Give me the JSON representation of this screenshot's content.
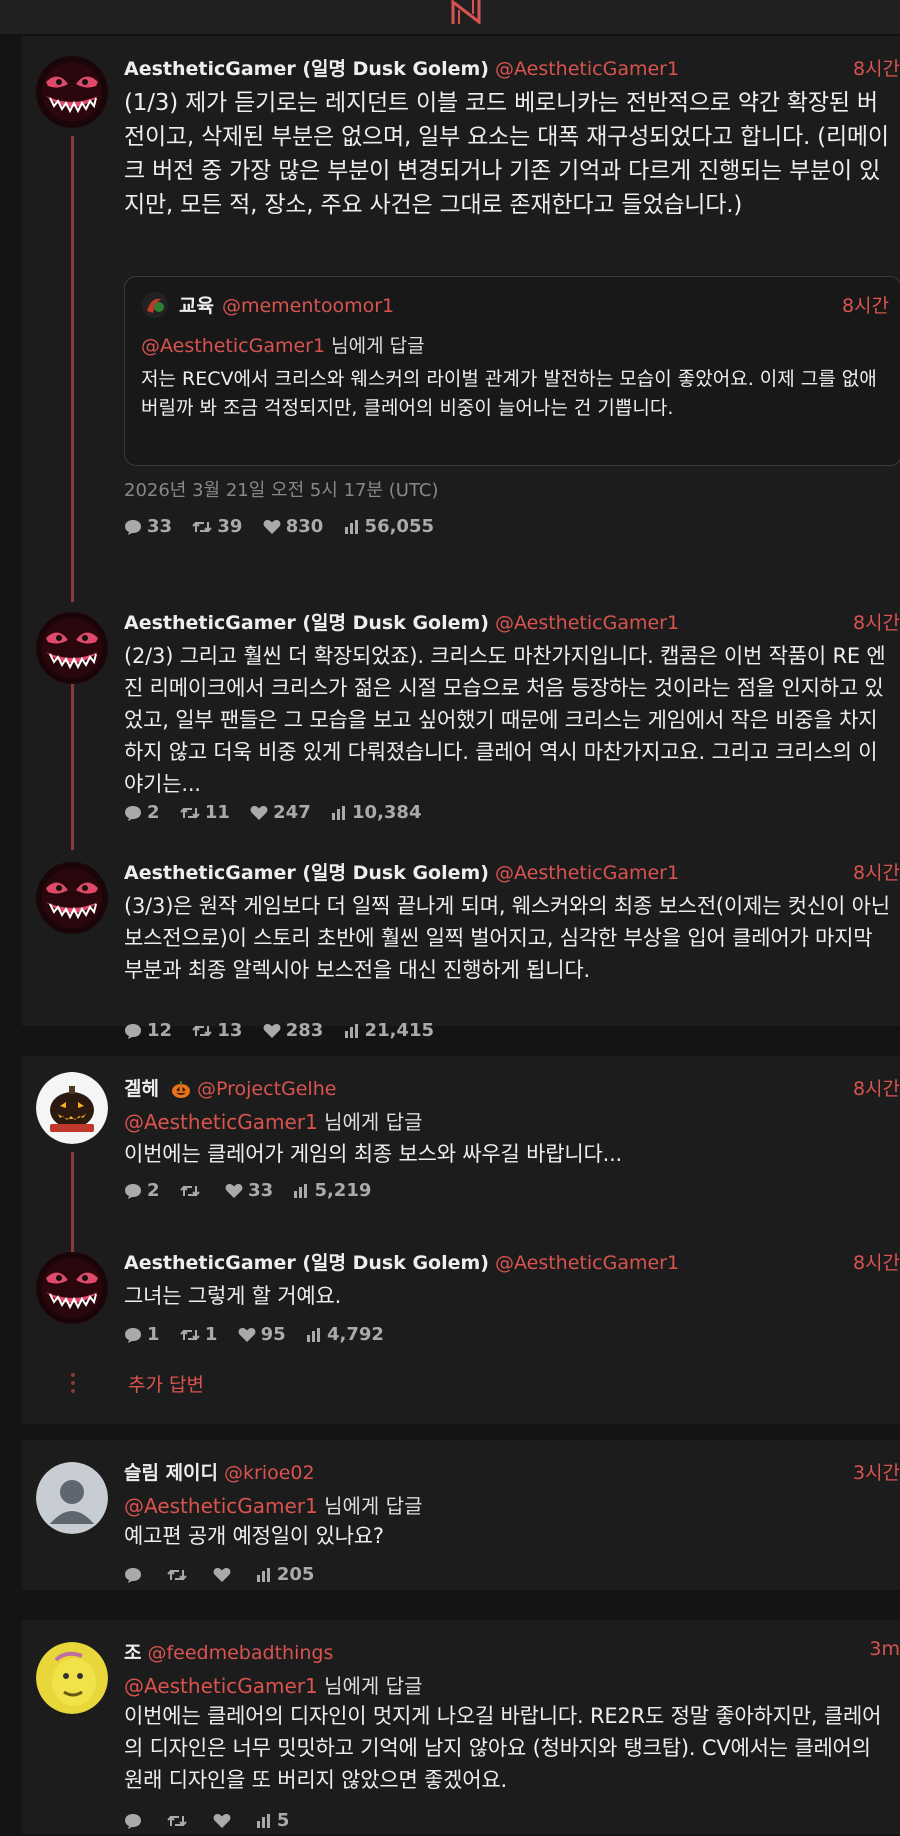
{
  "brand": {
    "accent": "#d9534f",
    "background": "#141414",
    "card": "#1c1c1c"
  },
  "tweets": [
    {
      "name": "AestheticGamer (일명 Dusk Golem)",
      "handle": "@AestheticGamer1",
      "time": "8시간",
      "text": "(1/3) 제가 듣기로는 레지던트 이블 코드 베로니카는 전반적으로 약간 확장된 버전이고, 삭제된 부분은 없으며, 일부 요소는 대폭 재구성되었다고 합니다. (리메이크 버전 중 가장 많은 부분이 변경되거나 기존 기억과 다르게 진행되는 부분이 있지만, 모든 적, 장소, 주요 사건은 그대로 존재한다고 들었습니다.)",
      "quote": {
        "name": "교육",
        "handle": "@mementoomor1",
        "time": "8시간",
        "reply_handle": "@AestheticGamer1",
        "reply_suffix": "님에게 답글",
        "text": "저는 RECV에서 크리스와 웨스커의 라이벌 관계가 발전하는 모습이 좋았어요. 이제 그를 없애버릴까 봐 조금 걱정되지만, 클레어의 비중이 늘어나는 건 기쁩니다."
      },
      "date": "2026년 3월 21일 오전 5시 17분 (UTC)",
      "stats": {
        "replies": "33",
        "retweets": "39",
        "likes": "830",
        "views": "56,055"
      }
    },
    {
      "name": "AestheticGamer (일명 Dusk Golem)",
      "handle": "@AestheticGamer1",
      "time": "8시간",
      "text": "(2/3) 그리고 훨씬 더 확장되었죠). 크리스도 마찬가지입니다. 캡콤은 이번 작품이 RE 엔진 리메이크에서 크리스가 젊은 시절 모습으로 처음 등장하는 것이라는 점을 인지하고 있었고, 일부 팬들은 그 모습을 보고 싶어했기 때문에 크리스는 게임에서 작은 비중을 차지하지 않고 더욱 비중 있게 다뤄졌습니다. 클레어 역시 마찬가지고요. 그리고 크리스의 이야기는...",
      "stats": {
        "replies": "2",
        "retweets": "11",
        "likes": "247",
        "views": "10,384"
      }
    },
    {
      "name": "AestheticGamer (일명 Dusk Golem)",
      "handle": "@AestheticGamer1",
      "time": "8시간",
      "text": "(3/3)은 원작 게임보다 더 일찍 끝나게 되며, 웨스커와의 최종 보스전(이제는 컷신이 아닌 보스전으로)이 스토리 초반에 훨씬 일찍 벌어지고, 심각한 부상을 입어 클레어가 마지막 부분과 최종 알렉시아 보스전을 대신 진행하게 됩니다.",
      "stats": {
        "replies": "12",
        "retweets": "13",
        "likes": "283",
        "views": "21,415"
      }
    }
  ],
  "replies": [
    {
      "name": "겔헤",
      "handle": "@ProjectGelhe",
      "time": "8시간",
      "reply_handle": "@AestheticGamer1",
      "reply_suffix": "님에게 답글",
      "text": "이번에는 클레어가 게임의 최종 보스와 싸우길 바랍니다...",
      "stats": {
        "replies": "2",
        "retweets": "",
        "likes": "33",
        "views": "5,219"
      }
    },
    {
      "name": "AestheticGamer (일명 Dusk Golem)",
      "handle": "@AestheticGamer1",
      "time": "8시간",
      "text": "그녀는 그렇게 할 거예요.",
      "stats": {
        "replies": "1",
        "retweets": "1",
        "likes": "95",
        "views": "4,792"
      }
    },
    {
      "name": "슬림 제이디",
      "handle": "@krioe02",
      "time": "3시간",
      "reply_handle": "@AestheticGamer1",
      "reply_suffix": "님에게 답글",
      "text": "예고편 공개 예정일이 있나요?",
      "stats": {
        "replies": "",
        "retweets": "",
        "likes": "",
        "views": "205"
      }
    },
    {
      "name": "조",
      "handle": "@feedmebadthings",
      "time": "3m",
      "reply_handle": "@AestheticGamer1",
      "reply_suffix": "님에게 답글",
      "text": "이번에는 클레어의 디자인이 멋지게 나오길 바랍니다. RE2R도 정말 좋아하지만, 클레어의 디자인은 너무 밋밋하고 기억에 남지 않아요 (청바지와 탱크탑). CV에서는 클레어의 원래 디자인을 또 버리지 않았으면 좋겠어요.",
      "stats": {
        "replies": "",
        "retweets": "",
        "likes": "",
        "views": "5"
      }
    }
  ],
  "more_replies_label": "추가 답변",
  "icons": {
    "reply": "speech-bubble-icon",
    "retweet": "retweet-icon",
    "like": "heart-icon",
    "views": "bar-chart-icon",
    "more": "vertical-dots-icon",
    "badge": "pumpkin-emoji-icon",
    "logo": "n-logo-icon"
  }
}
